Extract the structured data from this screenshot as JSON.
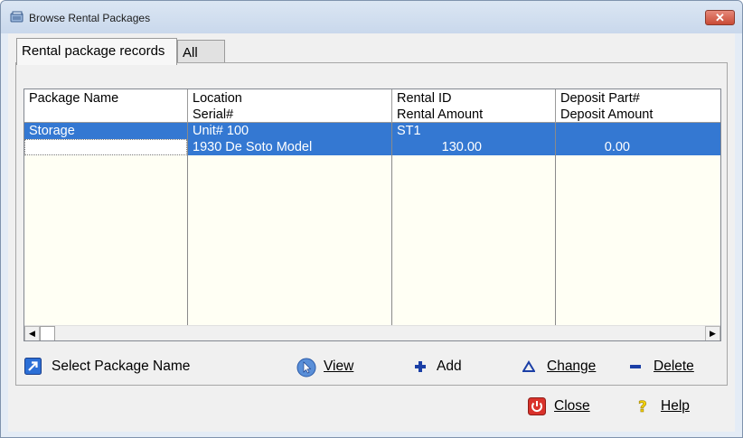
{
  "window": {
    "title": "Browse Rental Packages",
    "close_glyph": "✕"
  },
  "tabs": [
    {
      "label": "Rental package records",
      "active": true
    },
    {
      "label": "All",
      "active": false
    }
  ],
  "grid": {
    "columns": [
      {
        "line1": "Package Name",
        "line2": ""
      },
      {
        "line1": "Location",
        "line2": "Serial#"
      },
      {
        "line1": "Rental ID",
        "line2": "Rental Amount"
      },
      {
        "line1": "Deposit Part#",
        "line2": "Deposit Amount"
      }
    ],
    "rows": [
      {
        "package_name": "Storage",
        "location": "Unit# 100",
        "serial": "1930 De Soto Model",
        "rental_id": "ST1",
        "rental_amount": "130.00",
        "deposit_part": "",
        "deposit_amount": "0.00",
        "selected": true
      }
    ]
  },
  "actions": {
    "select": {
      "label": "Select Package Name",
      "icon": "select-arrow-icon"
    },
    "view": {
      "label": "View",
      "icon": "cursor-icon"
    },
    "add": {
      "label": "Add",
      "icon": "plus-icon"
    },
    "change": {
      "label": "Change",
      "icon": "triangle-icon"
    },
    "delete": {
      "label": "Delete",
      "icon": "minus-icon"
    }
  },
  "footer": {
    "close": {
      "label": "Close",
      "icon": "power-icon"
    },
    "help": {
      "label": "Help",
      "icon": "question-icon"
    }
  },
  "colors": {
    "selection": "#3478d2",
    "grid_background": "#fffff4",
    "action_icon_blue": "#1b3fa6",
    "close_red": "#d9322b",
    "help_yellow": "#f2d10c"
  }
}
